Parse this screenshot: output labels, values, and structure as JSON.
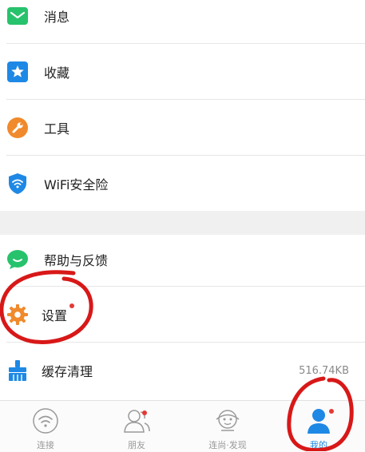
{
  "menu": {
    "items": [
      {
        "label": "消息",
        "icon": "envelope-icon"
      },
      {
        "label": "收藏",
        "icon": "star-icon"
      },
      {
        "label": "工具",
        "icon": "wrench-icon"
      },
      {
        "label": "WiFi安全险",
        "icon": "wifi-shield-icon"
      }
    ],
    "items2": [
      {
        "label": "帮助与反馈",
        "icon": "chat-bubble-icon"
      },
      {
        "label": "设置",
        "icon": "gear-icon",
        "badge_dot": true
      },
      {
        "label": "缓存清理",
        "icon": "broom-icon",
        "value": "516.74KB"
      }
    ]
  },
  "tabs": [
    {
      "label": "连接",
      "icon": "wifi-icon",
      "active": false
    },
    {
      "label": "朋友",
      "icon": "friends-icon",
      "active": false,
      "badge_dot": true
    },
    {
      "label": "连尚·发现",
      "icon": "discover-icon",
      "active": false
    },
    {
      "label": "我的",
      "icon": "user-icon",
      "active": true,
      "badge_dot": true
    }
  ],
  "colors": {
    "accent_blue": "#1e88e5",
    "green": "#27c26c",
    "orange": "#f08a2c",
    "red_dot": "#e53935",
    "annotation_red": "#d81818"
  }
}
